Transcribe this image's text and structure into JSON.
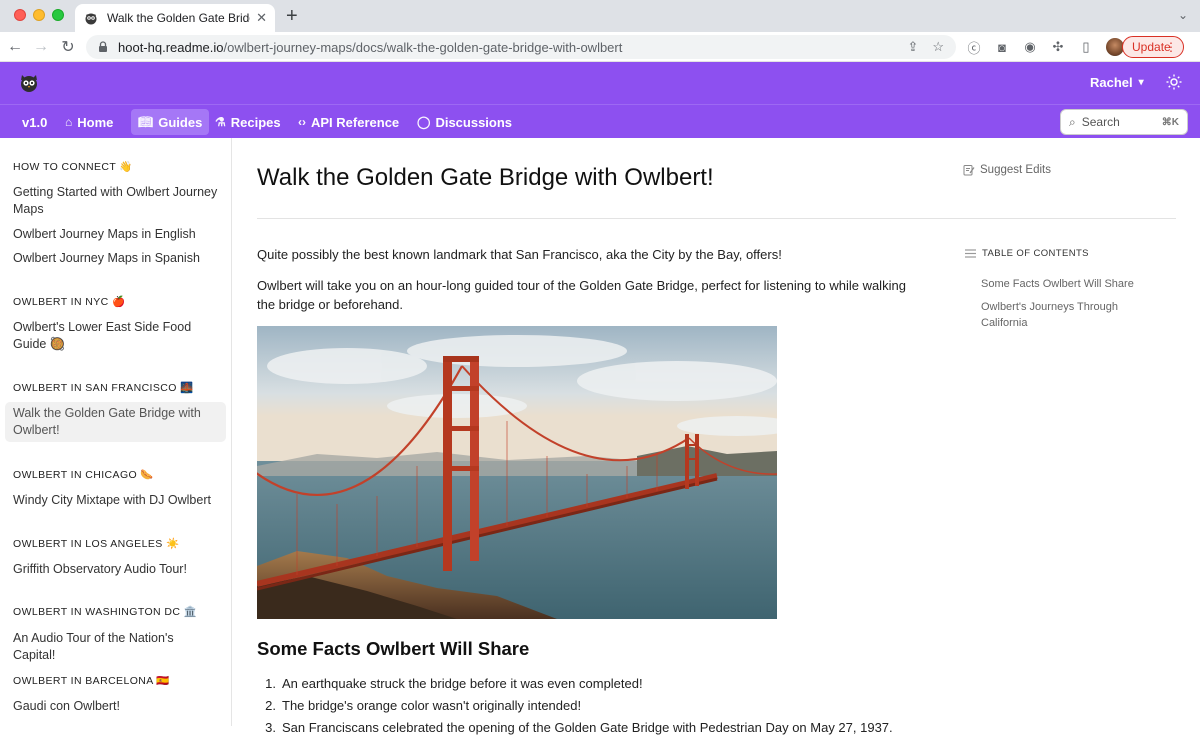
{
  "browser": {
    "tab_title": "Walk the Golden Gate Bridge with Owlbert",
    "url_host": "hoot-hq.readme.io",
    "url_path": "/owlbert-journey-maps/docs/walk-the-golden-gate-bridge-with-owlbert",
    "update_label": "Update"
  },
  "header": {
    "user_name": "Rachel",
    "version": "v1.0",
    "nav": [
      {
        "label": "Home",
        "icon": "home-icon"
      },
      {
        "label": "Guides",
        "icon": "book-icon",
        "active": true
      },
      {
        "label": "Recipes",
        "icon": "flask-icon"
      },
      {
        "label": "API Reference",
        "icon": "code-icon"
      },
      {
        "label": "Discussions",
        "icon": "chat-bubble-icon"
      }
    ],
    "search_placeholder": "Search",
    "search_shortcut": "⌘K",
    "accent_color": "#8d50f0"
  },
  "sidebar": {
    "sections": [
      {
        "title": "HOW TO CONNECT 👋",
        "items": [
          "Getting Started with Owlbert Journey Maps",
          "Owlbert Journey Maps in English",
          "Owlbert Journey Maps in Spanish"
        ]
      },
      {
        "title": "OWLBERT IN NYC 🍎",
        "items": [
          "Owlbert's Lower East Side Food Guide 🥘"
        ]
      },
      {
        "title": "OWLBERT IN SAN FRANCISCO 🌉",
        "items": [
          "Walk the Golden Gate Bridge with Owlbert!"
        ]
      },
      {
        "title": "OWLBERT IN CHICAGO 🌭",
        "items": [
          "Windy City Mixtape with DJ Owlbert"
        ]
      },
      {
        "title": "OWLBERT IN LOS ANGELES ☀️",
        "items": [
          "Griffith Observatory Audio Tour!"
        ]
      },
      {
        "title": "OWLBERT IN WASHINGTON DC 🏛️",
        "items": [
          "An Audio Tour of the Nation's Capital!"
        ]
      },
      {
        "title": "OWLBERT IN BARCELONA 🇪🇸",
        "items": [
          "Gaudi con Owlbert!"
        ]
      }
    ]
  },
  "page": {
    "title": "Walk the Golden Gate Bridge with Owlbert!",
    "suggest_edits": "Suggest Edits",
    "intro": "Quite possibly the best known landmark that San Francisco, aka the City by the Bay, offers!",
    "description": "Owlbert will take you on an hour-long guided tour of the Golden Gate Bridge, perfect for listening to while walking the bridge or beforehand.",
    "section_heading": "Some Facts Owlbert Will Share",
    "facts": [
      "An earthquake struck the bridge before it was even completed!",
      "The bridge's orange color wasn't originally intended!",
      "San Franciscans celebrated the opening of the Golden Gate Bridge with Pedestrian Day on May 27, 1937."
    ]
  },
  "toc": {
    "heading": "TABLE OF CONTENTS",
    "items": [
      "Some Facts Owlbert Will Share",
      "Owlbert's Journeys Through California"
    ]
  }
}
